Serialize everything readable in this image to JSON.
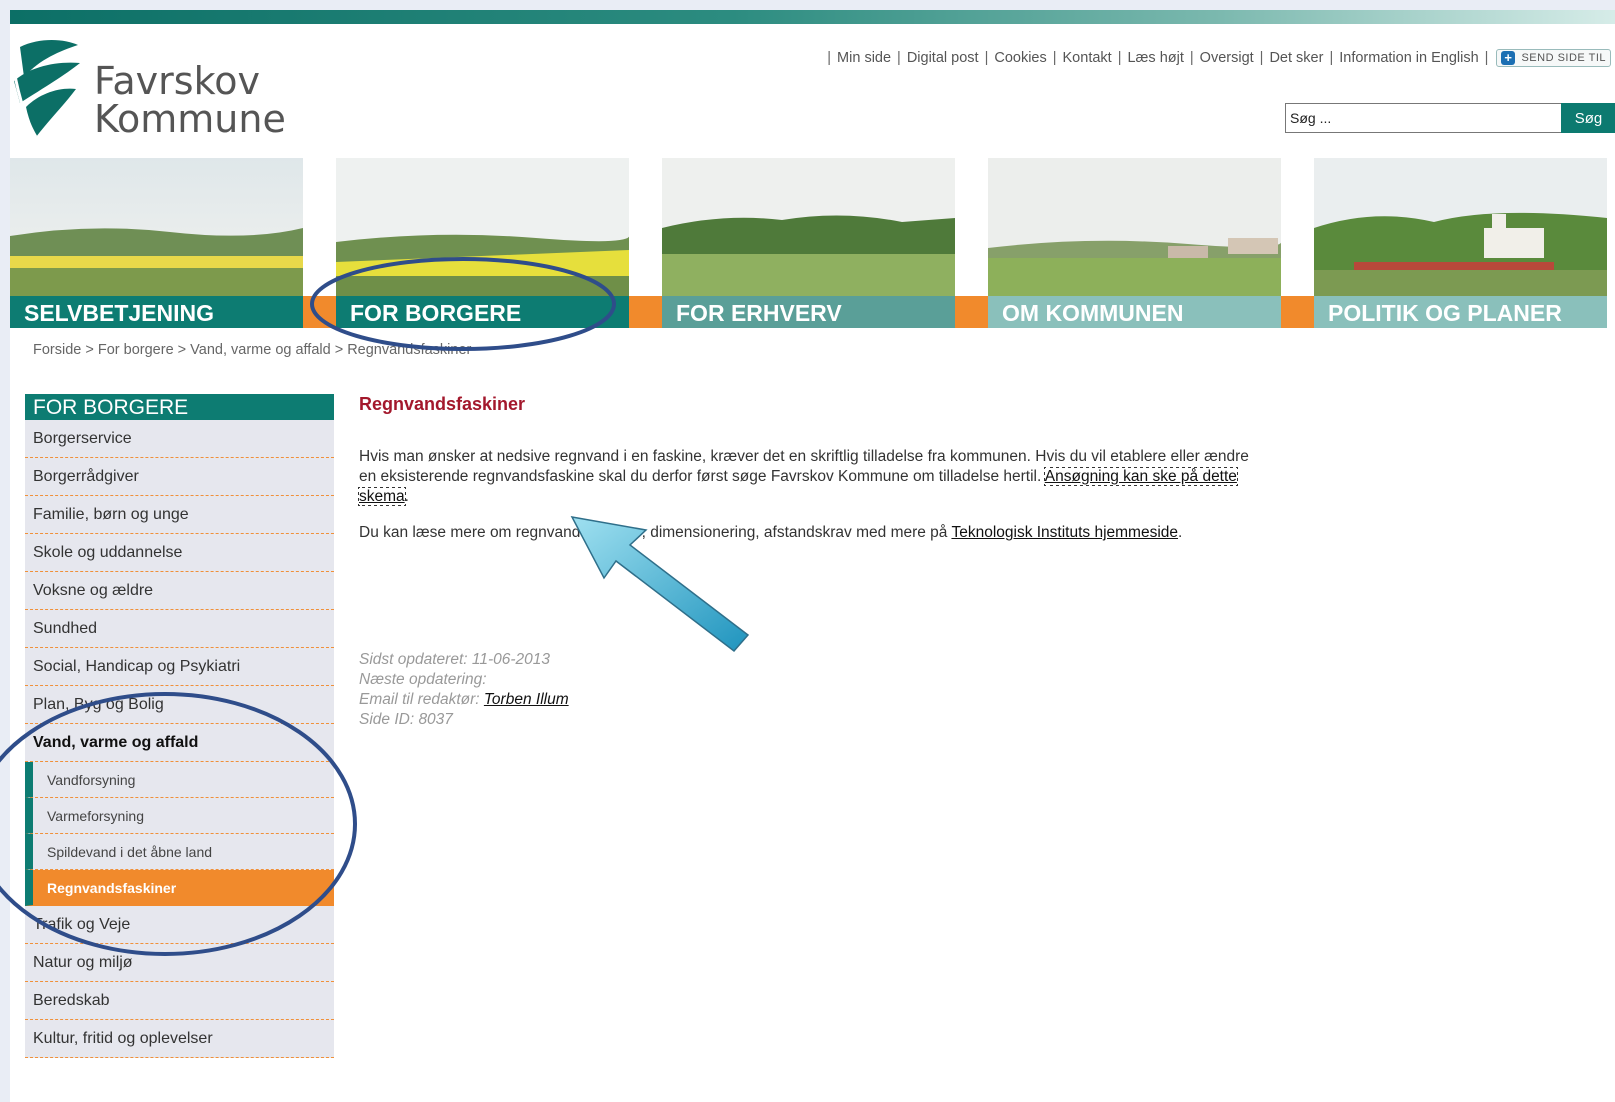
{
  "logo": {
    "line1": "Favrskov",
    "line2": "Kommune"
  },
  "utility_links": [
    "Min side",
    "Digital post",
    "Cookies",
    "Kontakt",
    "Læs højt",
    "Oversigt",
    "Det sker",
    "Information in English"
  ],
  "send_button_label": "SEND SIDE TIL",
  "search": {
    "placeholder": "Søg ...",
    "button_label": "Søg"
  },
  "nav": {
    "selvbetjening": "SELVBETJENING",
    "for_borgere": "FOR BORGERE",
    "for_erhverv": "FOR ERHVERV",
    "om_kommunen": "OM KOMMUNEN",
    "politik": "POLITIK OG PLANER"
  },
  "breadcrumb": "Forside > For borgere > Vand, varme og affald > Regnvandsfaskiner",
  "sidebar": {
    "header": "FOR BORGERE",
    "items_top": [
      "Borgerservice",
      "Borgerrådgiver",
      "Familie, børn og unge",
      "Skole og uddannelse",
      "Voksne og ældre",
      "Sundhed",
      "Social, Handicap og Psykiatri",
      "Plan, Byg og Bolig"
    ],
    "current_section": "Vand, varme og affald",
    "sub_items": [
      "Vandforsyning",
      "Varmeforsyning",
      "Spildevand i det åbne land",
      "Regnvandsfaskiner"
    ],
    "items_bottom": [
      "Trafik og Veje",
      "Natur og miljø",
      "Beredskab",
      "Kultur, fritid og oplevelser"
    ]
  },
  "main": {
    "title": "Regnvandsfaskiner",
    "p1_text": "Hvis man ønsker at nedsive regnvand i en faskine, kræver det en skriftlig tilladelse fra kommunen. Hvis du vil etablere eller ændre en eksisterende regnvandsfaskine skal du derfor først søge Favrskov Kommune om tilladelse hertil. ",
    "p1_link": "Ansøgning kan ske på dette skema",
    "p1_end": ".",
    "p2_text": "Du kan læse mere om regnvandsfaskiner, dimensionering, afstandskrav med mere på ",
    "p2_link": "Teknologisk Instituts hjemmeside",
    "p2_end": "."
  },
  "meta": {
    "updated": "Sidst opdateret: 11-06-2013",
    "next": "Næste opdatering:",
    "email_label": "Email til redaktør: ",
    "editor": "Torben Illum",
    "page_id": "Side ID: 8037"
  },
  "colors": {
    "teal": "#0d7c72",
    "orange": "#f18a2c",
    "title_red": "#a3182c",
    "annotation_blue": "#2f4d8a",
    "arrow_cyan": "#3fb7d6"
  }
}
